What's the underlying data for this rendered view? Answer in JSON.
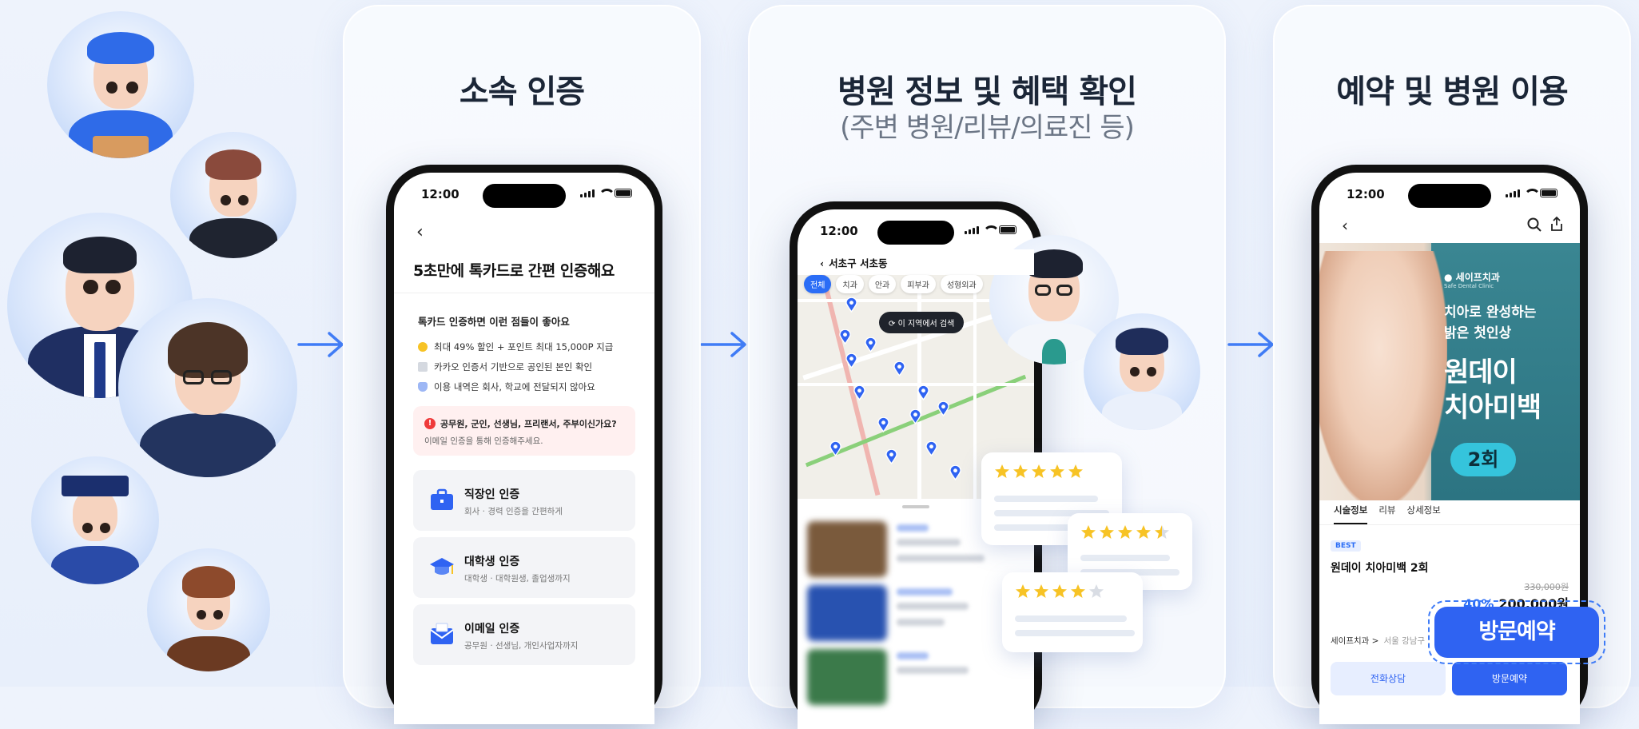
{
  "colors": {
    "accent": "#2f63f2",
    "arrow": "#3f7cf7",
    "star": "#f7c325",
    "title": "#1b2637"
  },
  "panel1": {
    "title": "소속 인증",
    "phone": {
      "time": "12:00",
      "heading": "5초만에 톡카드로 간편 인증해요",
      "benefit_title": "톡카드 인증하면 이런 점들이 좋아요",
      "benefits": [
        "최대 49% 할인 + 포인트 최대 15,000P 지급",
        "카카오 인증서 기반으로 공인된 본인 확인",
        "이용 내역은 회사, 학교에 전달되지 않아요"
      ],
      "alert_title": "공무원, 군인, 선생님, 프리랜서, 주부이신가요?",
      "alert_body": "이메일 인증을 통해 인증해주세요.",
      "cards": [
        {
          "title": "직장인 인증",
          "sub": "회사 · 경력 인증을 간편하게",
          "icon": "briefcase-icon"
        },
        {
          "title": "대학생 인증",
          "sub": "대학생 · 대학원생, 졸업생까지",
          "icon": "graduation-cap-icon"
        },
        {
          "title": "이메일 인증",
          "sub": "공무원 · 선생님, 개인사업자까지",
          "icon": "mail-icon"
        }
      ]
    }
  },
  "panel2": {
    "title": "병원 정보 및 혜택 확인",
    "subtitle": "(주변 병원/리뷰/의료진 등)",
    "phone": {
      "time": "12:00",
      "location": "서초구 서초동",
      "chips": [
        "전체",
        "치과",
        "안과",
        "피부과",
        "성형외과"
      ],
      "search_here": "이 지역에서 검색"
    },
    "reviews": [
      {
        "rating": 5
      },
      {
        "rating": 4.5
      },
      {
        "rating": 4
      }
    ]
  },
  "panel3": {
    "title": "예약 및 병원 이용",
    "phone": {
      "time": "12:00",
      "brand": "세이프치과",
      "brand_sub": "Safe Dental Clinic",
      "banner_line1": "치아로 완성하는",
      "banner_line2": "밝은 첫인상",
      "banner_big1": "원데이",
      "banner_big2": "치아미백",
      "banner_badge": "2회",
      "tabs": [
        "시술정보",
        "리뷰",
        "상세정보"
      ],
      "best": "BEST",
      "product": "원데이 치아미백 2회",
      "original_price": "330,000원",
      "discount": "40%",
      "price": "200,000원",
      "clinic": "세이프치과 >",
      "clinic_addr": "서울 강남구",
      "btn_call": "전화상담",
      "btn_visit": "방문예약"
    },
    "cta": "방문예약"
  }
}
